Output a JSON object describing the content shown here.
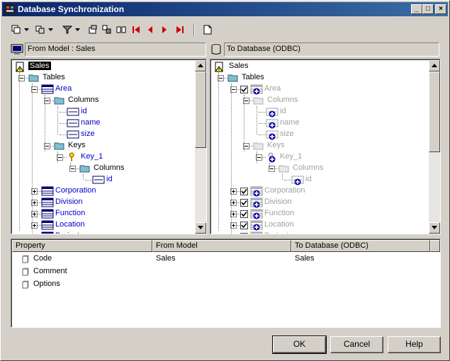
{
  "window": {
    "title": "Database Synchronization",
    "buttons": [
      "_",
      "□",
      "×"
    ]
  },
  "colors": {
    "titlebar": "#0a246a",
    "link": "#0000cc",
    "disabled": "#a0a0a0",
    "key": "#d4a000",
    "arrows": "#cc0000"
  },
  "toolbar": {
    "icons": [
      "select-all-icon",
      "dropdown-icon",
      "merge-icon",
      "dropdown-icon",
      "filter-icon",
      "dropdown-icon",
      "properties-icon",
      "compare-icon",
      "side-by-side-icon",
      "first-difference-icon",
      "previous-difference-icon",
      "next-difference-icon",
      "last-difference-icon",
      "report-icon"
    ]
  },
  "left_pane": {
    "header": "From Model : Sales",
    "tree": [
      {
        "label": "Sales",
        "selected": true
      },
      {
        "label": "Tables"
      },
      {
        "label": "Area"
      },
      {
        "label": "Columns"
      },
      {
        "label": "id"
      },
      {
        "label": "name"
      },
      {
        "label": "size"
      },
      {
        "label": "Keys"
      },
      {
        "label": "Key_1"
      },
      {
        "label": "Columns"
      },
      {
        "label": "id"
      },
      {
        "label": "Corporation"
      },
      {
        "label": "Division"
      },
      {
        "label": "Function"
      },
      {
        "label": "Location"
      },
      {
        "label": "Project"
      }
    ]
  },
  "right_pane": {
    "header": "To Database (ODBC)",
    "tree": [
      {
        "label": "Sales"
      },
      {
        "label": "Tables"
      },
      {
        "label": "Area",
        "checked": true
      },
      {
        "label": "Columns"
      },
      {
        "label": "id"
      },
      {
        "label": "name"
      },
      {
        "label": "size"
      },
      {
        "label": "Keys"
      },
      {
        "label": "Key_1"
      },
      {
        "label": "Columns"
      },
      {
        "label": "id"
      },
      {
        "label": "Corporation",
        "checked": true
      },
      {
        "label": "Division",
        "checked": true
      },
      {
        "label": "Function",
        "checked": true
      },
      {
        "label": "Location",
        "checked": true
      },
      {
        "label": "Project",
        "checked": true
      }
    ]
  },
  "properties": {
    "columns": [
      "Property",
      "From Model",
      "To Database (ODBC)"
    ],
    "rows": [
      {
        "name": "Code",
        "from": "Sales",
        "to": "Sales"
      },
      {
        "name": "Comment",
        "from": "",
        "to": ""
      },
      {
        "name": "Options",
        "from": "",
        "to": ""
      }
    ]
  },
  "buttons": {
    "ok": "OK",
    "cancel": "Cancel",
    "help": "Help"
  }
}
